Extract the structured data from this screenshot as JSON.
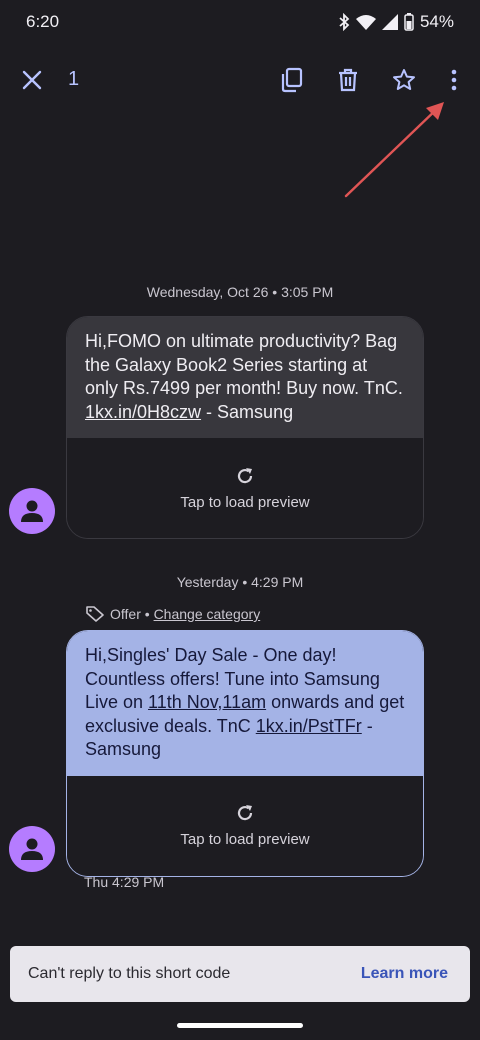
{
  "status_bar": {
    "time": "6:20",
    "battery": "54%"
  },
  "toolbar": {
    "selected_count": "1"
  },
  "messages": [
    {
      "date": "Wednesday, Oct 26 • 3:05 PM",
      "text_before": "Hi,FOMO on ultimate productivity? Bag the Galaxy Book2 Series starting at only Rs.7499 per month! Buy now. TnC. ",
      "link": "1kx.in/0H8czw",
      "text_after": " - Samsung",
      "preview_label": "Tap to load preview"
    },
    {
      "date": "Yesterday • 4:29 PM",
      "tag_label": "Offer",
      "tag_sep": " • ",
      "change_category": "Change category",
      "text_1": "Hi,Singles' Day Sale - One day! Countless offers! Tune into Samsung Live on ",
      "link_1": "11th Nov,11am",
      "text_2": " onwards and get exclusive deals. TnC ",
      "link_2": "1kx.in/PstTFr",
      "text_3": " - Samsung",
      "preview_label": "Tap to load preview",
      "time": "Thu 4:29 PM"
    }
  ],
  "reply_banner": {
    "message": "Can't reply to this short code",
    "action": "Learn more"
  },
  "colors": {
    "accent": "#b8c3ff",
    "sent_bubble": "#a4b3e6",
    "avatar": "#b57cff",
    "annotation_arrow": "#e05555"
  }
}
